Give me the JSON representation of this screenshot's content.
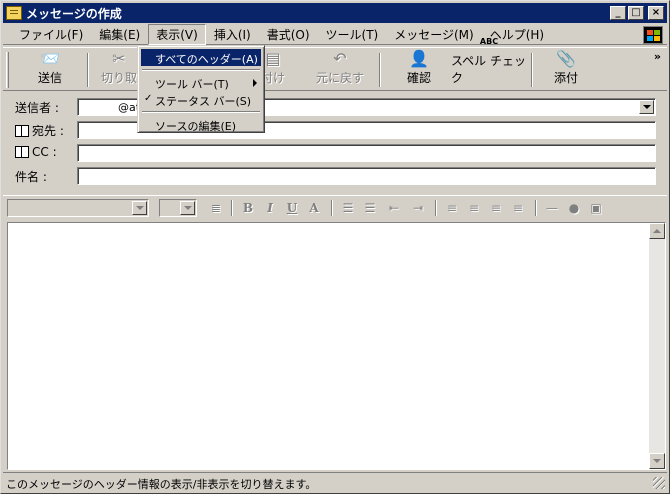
{
  "window": {
    "title": "メッセージの作成",
    "controls": {
      "minimize": "_",
      "maximize": "□",
      "close": "×"
    }
  },
  "menubar": {
    "items": [
      {
        "label": "ファイル(F)"
      },
      {
        "label": "編集(E)"
      },
      {
        "label": "表示(V)"
      },
      {
        "label": "挿入(I)"
      },
      {
        "label": "書式(O)"
      },
      {
        "label": "ツール(T)"
      },
      {
        "label": "メッセージ(M)"
      },
      {
        "label": "ヘルプ(H)"
      }
    ],
    "active": "表示(V)"
  },
  "toolbar": {
    "send": "送信",
    "cut": "切り取",
    "paste": "付け",
    "undo": "元に戻す",
    "check": "確認",
    "spell": "スペル チェック",
    "attach": "添付",
    "spell_icon_text": "ABC",
    "more": "»"
  },
  "view_menu": {
    "items": [
      {
        "label": "すべてのヘッダー(A)",
        "highlighted": true
      },
      {
        "label": "ツール バー(T)",
        "submenu": true
      },
      {
        "label": "ステータス バー(S)",
        "checked": true
      },
      {
        "label": "ソースの編集(E)"
      }
    ],
    "check_mark": "✓"
  },
  "header": {
    "from_label": "送信者 :",
    "from_value": "@atc",
    "to_label": "宛先 :",
    "cc_label": "CC :",
    "subject_label": "件名 :",
    "to_value": "",
    "cc_value": "",
    "subject_value": ""
  },
  "format": {
    "bold": "B",
    "italic": "I",
    "underline": "U",
    "font_color": "A"
  },
  "status": {
    "text": "このメッセージのヘッダー情報の表示/非表示を切り替えます。"
  },
  "colors": {
    "titlebar": "#0a246a",
    "face": "#d4d0c8",
    "highlight": "#0a246a"
  }
}
